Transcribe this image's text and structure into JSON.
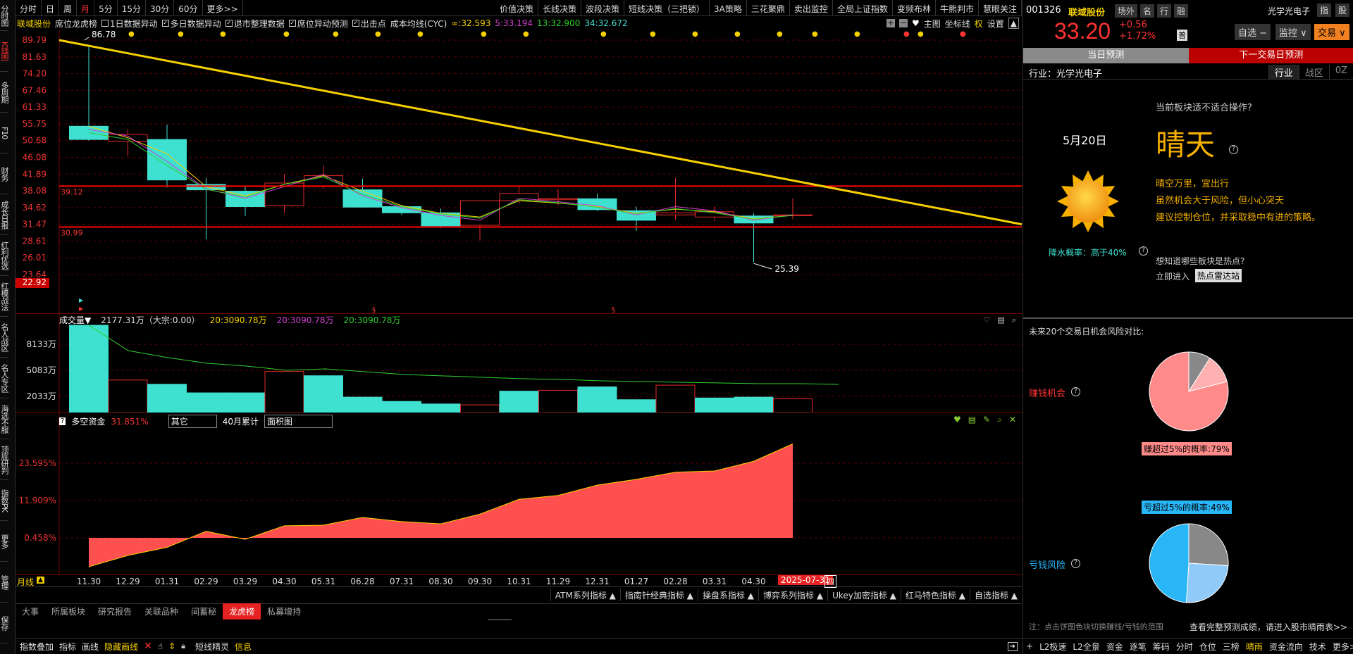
{
  "left_nav": [
    "分时图",
    "K线图",
    "多周期",
    "F10",
    "财务",
    "成长日报",
    "红利优选",
    "红模战法",
    "名人战区",
    "名人专区",
    "海选不服",
    "顶底研判",
    "指数PK",
    "更多",
    "管理",
    "保存"
  ],
  "toolbar": {
    "periods": [
      "分时",
      "日",
      "周",
      "月",
      "5分",
      "15分",
      "30分",
      "60分",
      "更多>>"
    ],
    "active_period": "月",
    "right_items": [
      "价值决策",
      "长线决策",
      "波段决策",
      "短线决策（三把锁）",
      "3A策略",
      "三花聚鼎",
      "卖出监控",
      "全局上证指数",
      "变频布林",
      "牛熊判市",
      "慧眼关注"
    ]
  },
  "info_row": {
    "stock_name": "联域股份",
    "label1": "席位龙虎榜",
    "checks": [
      {
        "label": "1日数据异动",
        "checked": false
      },
      {
        "label": "多日数据异动",
        "checked": true
      },
      {
        "label": "退市整理数据",
        "checked": true
      },
      {
        "label": "席位异动预测",
        "checked": true
      },
      {
        "label": "出击点",
        "checked": true
      }
    ],
    "cyc_label": "成本均线(CYC)",
    "cyc_values": [
      "∞:32.593",
      "5:33.194",
      "13:32.900",
      "34:32.672"
    ],
    "right": [
      "主图",
      "坐标线",
      "权",
      "设置"
    ]
  },
  "kchart": {
    "y_ticks": [
      "89.79",
      "81.63",
      "74.20",
      "67.46",
      "61.33",
      "55.75",
      "50.68",
      "46.08",
      "41.89",
      "38.08",
      "34.62",
      "31.47",
      "28.61",
      "26.01",
      "23.64"
    ],
    "y_low": "22.92",
    "high_mark": "86.78",
    "low_mark": "25.39",
    "line_upper": "39.12",
    "line_lower": "30.99"
  },
  "vol": {
    "title": "成交量▼",
    "value": "2177.31万（大宗:0.00）",
    "ma": [
      "20:3090.78万",
      "20:3090.78万",
      "20:3090.78万"
    ],
    "y_ticks": [
      "8133万",
      "5083万",
      "2033万"
    ]
  },
  "fund": {
    "title": "多空资金",
    "pct": "31.851%",
    "sel1": "其它",
    "label": "40月累计",
    "sel2": "面积图",
    "y_ticks": [
      "23.595%",
      "11.909%",
      "0.458%"
    ]
  },
  "x_axis": {
    "label": "月线",
    "ticks": [
      "11.30",
      "12.29",
      "01.31",
      "02.29",
      "03.29",
      "04.30",
      "05.31",
      "06.28",
      "07.31",
      "08.30",
      "09.30",
      "10.31",
      "11.29",
      "12.31",
      "01.27",
      "02.28",
      "03.31",
      "04.30",
      "05."
    ],
    "date": "2025-07-31",
    "extra": "四"
  },
  "indicators": [
    "ATM系列指标 ▲",
    "指南针经典指标 ▲",
    "操盘系指标 ▲",
    "博弈系列指标 ▲",
    "Ukey加密指标 ▲",
    "红马特色指标 ▲",
    "自选指标 ▲"
  ],
  "tabs": [
    "大事",
    "所属板块",
    "研究报告",
    "关联品种",
    "间蓄秘",
    "龙虎榜",
    "私募增持"
  ],
  "active_tab": "龙虎榜",
  "bottom": [
    "指数叠加",
    "指标",
    "画线",
    "隐藏画线"
  ],
  "bottom_extra": [
    "短线精灵",
    "信息"
  ],
  "right_panel": {
    "code": "001326",
    "name": "联域股份",
    "tags": [
      "场外",
      "名",
      "行",
      "融"
    ],
    "industry_name": "光学光电子",
    "top_btns": [
      "指",
      "股"
    ],
    "price": "33.20",
    "change": "+0.56",
    "change_pct": "+1.72%",
    "fin_tag": "普",
    "btns": [
      "自选 −",
      "监控 ∨",
      "交易 ∨"
    ],
    "tab_today": "当日预测",
    "tab_next": "下一交易日预测",
    "industry": "行业：光学光电子",
    "ind_tabs": [
      "行业",
      "战区",
      "0Z"
    ],
    "question": "当前板块适不适合操作?",
    "date": "5月20日",
    "weather": "晴天",
    "desc": [
      "晴空万里，宜出行",
      "虽然机会大于风险，但小心突天",
      "建议控制仓位，并采取稳中有进的策略。"
    ],
    "rain": "降水概率：高于40%",
    "hot_q": "想知道哪些板块是热点?",
    "enter": "立即进入",
    "hot_btn": "热点雷达站",
    "compare_title": "未来20个交易日机会风险对比:",
    "earn_label": "赚钱机会",
    "earn_pct": "赚超过5%的概率:79%",
    "earn_value": 79,
    "loss_pct": "亏超过5%的概率:49%",
    "loss_value": 49,
    "loss_label": "亏钱风险",
    "note": "注：点击饼图色块切换赚钱/亏钱的范围",
    "more_link": "查看完整预测成绩，请进入股市晴雨表>>",
    "bottom_items": [
      "L2极速",
      "L2全景",
      "资金",
      "逐笔",
      "筹码",
      "分时",
      "仓位",
      "三榜",
      "晴雨",
      "资金流向",
      "技术",
      "更多>>"
    ],
    "bottom_active": "晴雨"
  },
  "colors": {
    "up": "#e82a2a",
    "down": "#3ee0d0",
    "yellow": "#f5d000",
    "accent": "#e62222"
  }
}
